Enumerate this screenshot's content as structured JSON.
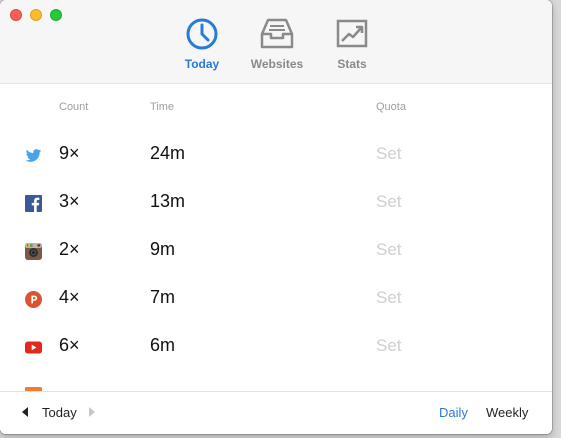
{
  "toolbar": {
    "tabs": [
      {
        "label": "Today",
        "icon": "clock-icon",
        "active": true
      },
      {
        "label": "Websites",
        "icon": "inbox-tray-icon",
        "active": false
      },
      {
        "label": "Stats",
        "icon": "trend-chart-icon",
        "active": false
      }
    ]
  },
  "table": {
    "headers": {
      "count": "Count",
      "time": "Time",
      "quota": "Quota"
    },
    "rows": [
      {
        "site": "Twitter",
        "icon": "twitter-icon",
        "count": "9×",
        "time": "24m",
        "quota": "Set"
      },
      {
        "site": "Facebook",
        "icon": "facebook-icon",
        "count": "3×",
        "time": "13m",
        "quota": "Set"
      },
      {
        "site": "Instagram",
        "icon": "instagram-icon",
        "count": "2×",
        "time": "9m",
        "quota": "Set"
      },
      {
        "site": "Product Hunt",
        "icon": "producthunt-icon",
        "count": "4×",
        "time": "7m",
        "quota": "Set"
      },
      {
        "site": "YouTube",
        "icon": "youtube-icon",
        "count": "6×",
        "time": "6m",
        "quota": "Set"
      }
    ]
  },
  "footer": {
    "period_label": "Today",
    "daily_label": "Daily",
    "weekly_label": "Weekly"
  },
  "colors": {
    "accent": "#2a7ad8",
    "quota_inactive": "#cfcfcf",
    "twitter": "#4aa3e8",
    "facebook": "#3b5998",
    "instagram": "#7b5a45",
    "producthunt": "#da552f",
    "youtube": "#e02a20"
  }
}
